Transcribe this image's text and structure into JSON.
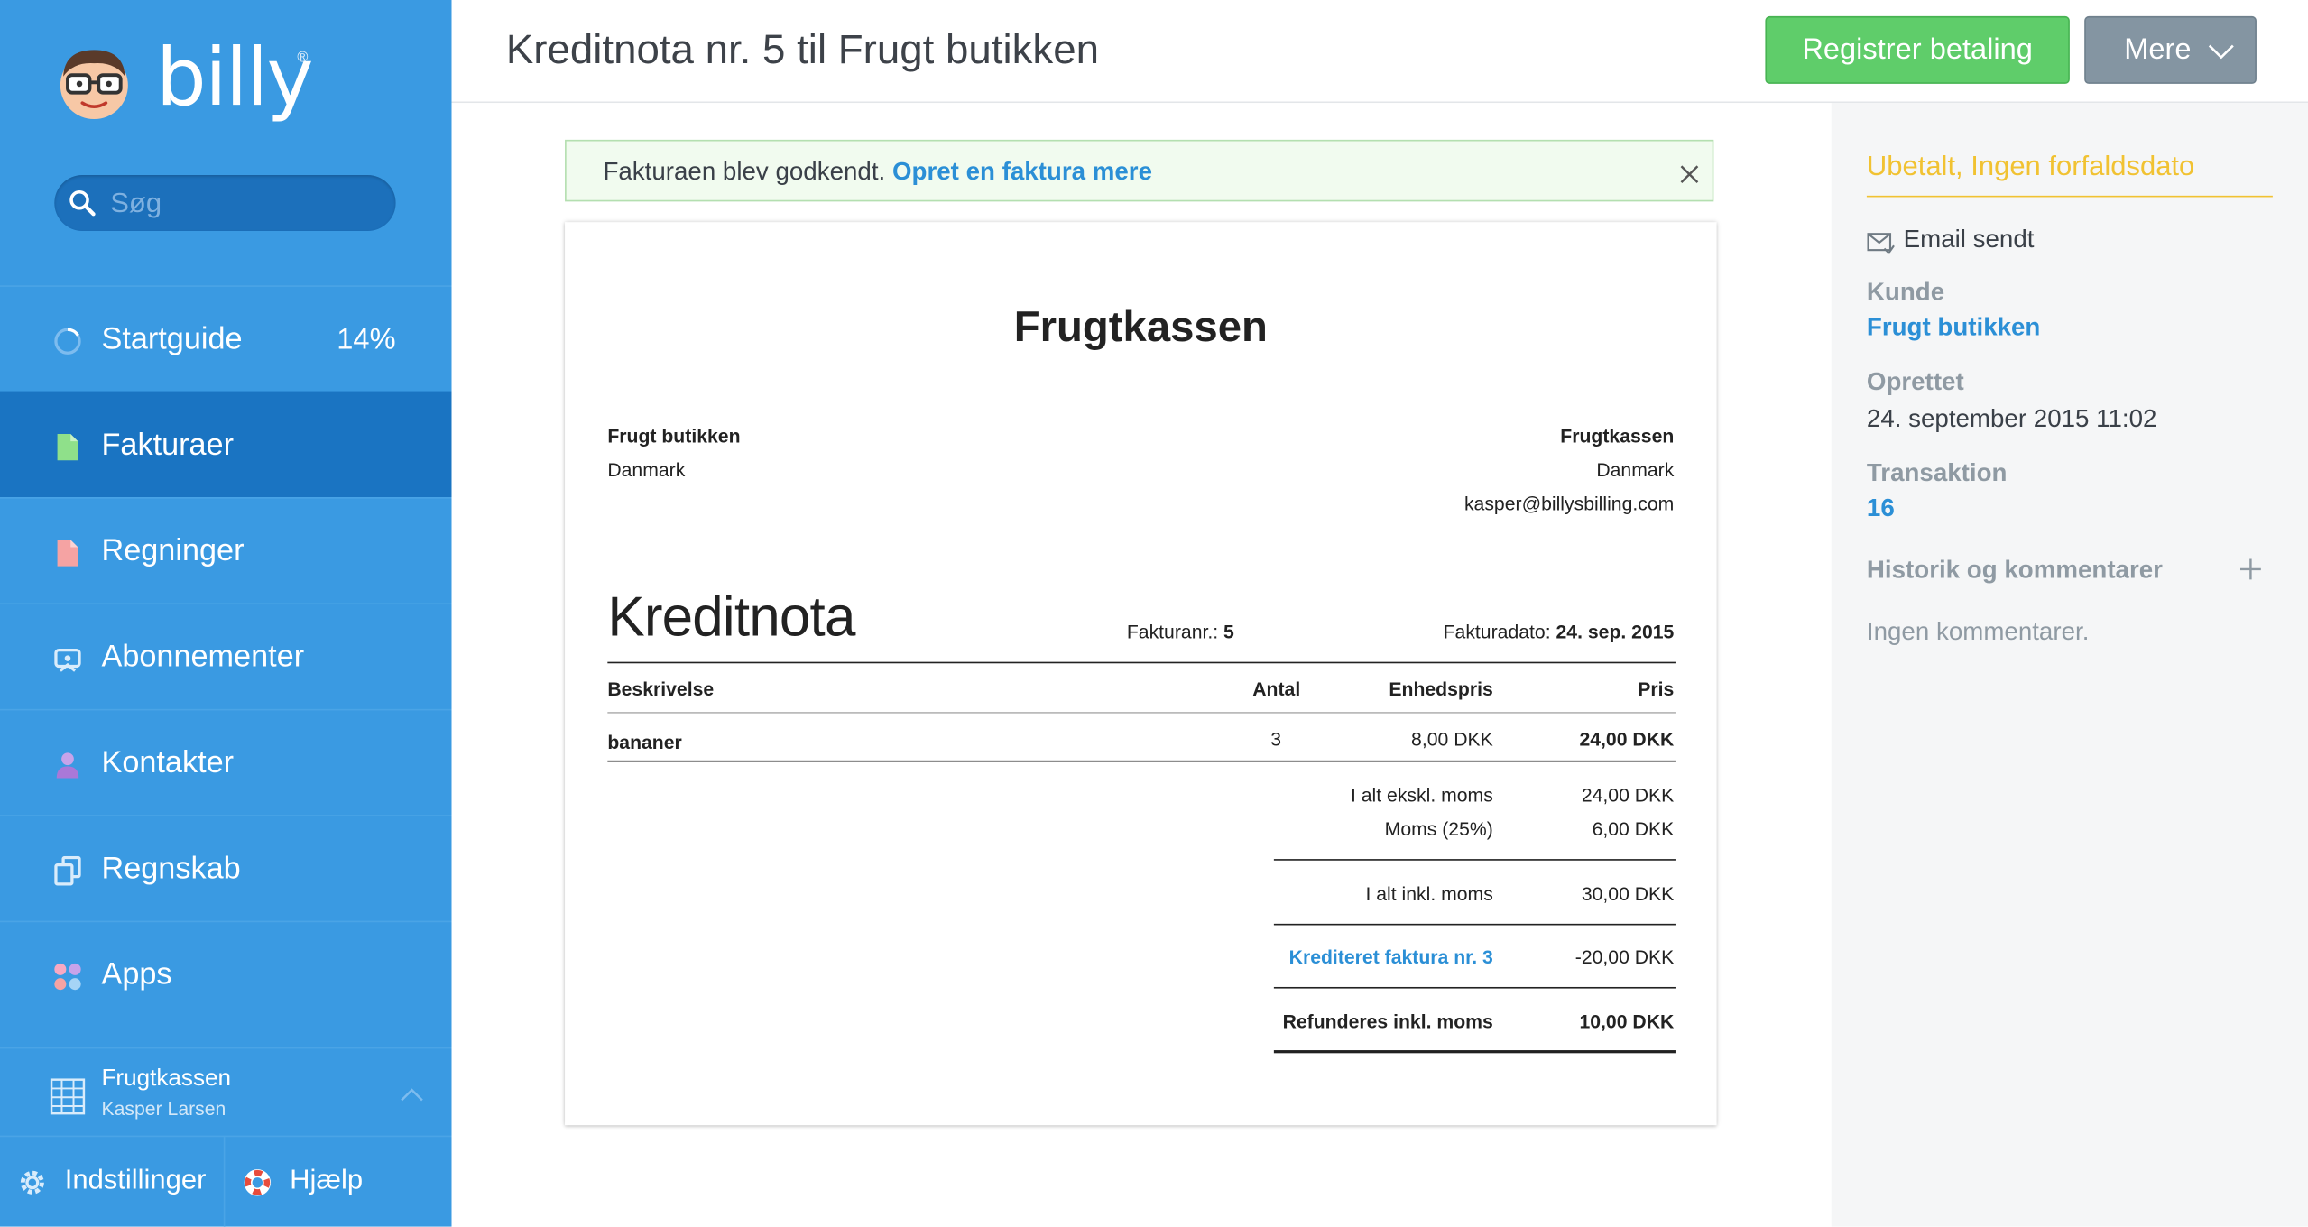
{
  "sidebar": {
    "logo_text": "billy",
    "logo_mark": "®",
    "search_placeholder": "Søg",
    "nav": [
      {
        "label": "Startguide",
        "meta": "14%",
        "icon": "progress-ring-icon"
      },
      {
        "label": "Fakturaer",
        "icon": "invoice-document-icon",
        "active": true
      },
      {
        "label": "Regninger",
        "icon": "bill-document-icon"
      },
      {
        "label": "Abonnementer",
        "icon": "subscription-icon"
      },
      {
        "label": "Kontakter",
        "icon": "contact-person-icon"
      },
      {
        "label": "Regnskab",
        "icon": "accounting-icon"
      },
      {
        "label": "Apps",
        "icon": "apps-icon"
      }
    ],
    "org_name": "Frugtkassen",
    "org_user": "Kasper Larsen",
    "settings_label": "Indstillinger",
    "help_label": "Hjælp"
  },
  "header": {
    "title": "Kreditnota nr. 5 til Frugt butikken",
    "pay_button": "Registrer betaling",
    "more_button": "Mere"
  },
  "alert": {
    "message": "Fakturaen blev godkendt.",
    "link": "Opret en faktura mere"
  },
  "document": {
    "company": "Frugtkassen",
    "recipient_name": "Frugt butikken",
    "recipient_country": "Danmark",
    "sender_name": "Frugtkassen",
    "sender_country": "Danmark",
    "sender_email": "kasper@billysbilling.com",
    "heading": "Kreditnota",
    "invoice_no_label": "Fakturanr.:",
    "invoice_no": "5",
    "date_label": "Fakturadato:",
    "date": "24. sep. 2015",
    "columns": {
      "description": "Beskrivelse",
      "quantity": "Antal",
      "unit_price": "Enhedspris",
      "price": "Pris"
    },
    "lines": [
      {
        "description": "bananer",
        "quantity": "3",
        "unit_price": "8,00 DKK",
        "price": "24,00 DKK"
      }
    ],
    "subtotal_label": "I alt ekskl. moms",
    "subtotal": "24,00 DKK",
    "vat_label": "Moms (25%)",
    "vat": "6,00 DKK",
    "total_label": "I alt inkl. moms",
    "total": "30,00 DKK",
    "credited_label": "Krediteret faktura nr. 3",
    "credited": "-20,00 DKK",
    "refund_label": "Refunderes inkl. moms",
    "refund": "10,00 DKK"
  },
  "panel": {
    "status": "Ubetalt, Ingen forfaldsdato",
    "email_sent": "Email sendt",
    "customer_label": "Kunde",
    "customer": "Frugt butikken",
    "created_label": "Oprettet",
    "created": "24. september 2015 11:02",
    "transaction_label": "Transaktion",
    "transaction": "16",
    "history_label": "Historik og kommentarer",
    "no_comments": "Ingen kommentarer."
  },
  "colors": {
    "sidebar": "#3a9ae2",
    "sidebar_active": "#1a74c2",
    "pay_button": "#5fcd6a",
    "more_button": "#8495a2",
    "link": "#2b8fd6",
    "status": "#f1c232"
  }
}
